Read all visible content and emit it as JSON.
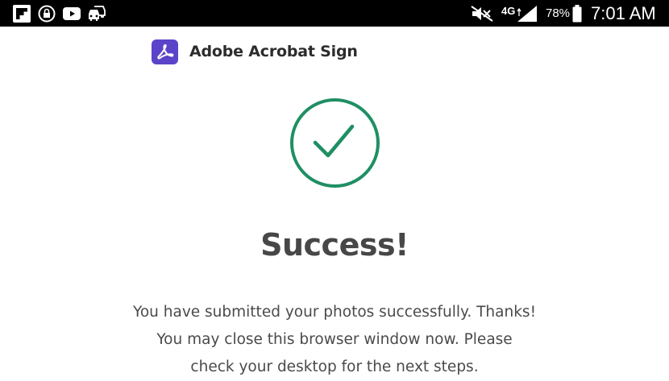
{
  "status_bar": {
    "battery_percent": "78%",
    "time": "7:01 AM",
    "network_type": "4G",
    "left_icons": [
      "flipboard-icon",
      "vpn-lock-icon",
      "youtube-icon",
      "car-mode-icon"
    ],
    "right_icons": [
      "mute-icon",
      "signal-icon",
      "battery-icon"
    ]
  },
  "brand": {
    "name": "Adobe Acrobat Sign",
    "logo_icon": "acrobat-logo-icon",
    "logo_color": "#5b44c9"
  },
  "result": {
    "icon": "checkmark-circle-icon",
    "icon_color": "#1f8f63",
    "title": "Success!",
    "message_lines": [
      "You have submitted your photos successfully. Thanks!",
      "You may close this browser window now. Please",
      "check your desktop for the next steps."
    ]
  }
}
